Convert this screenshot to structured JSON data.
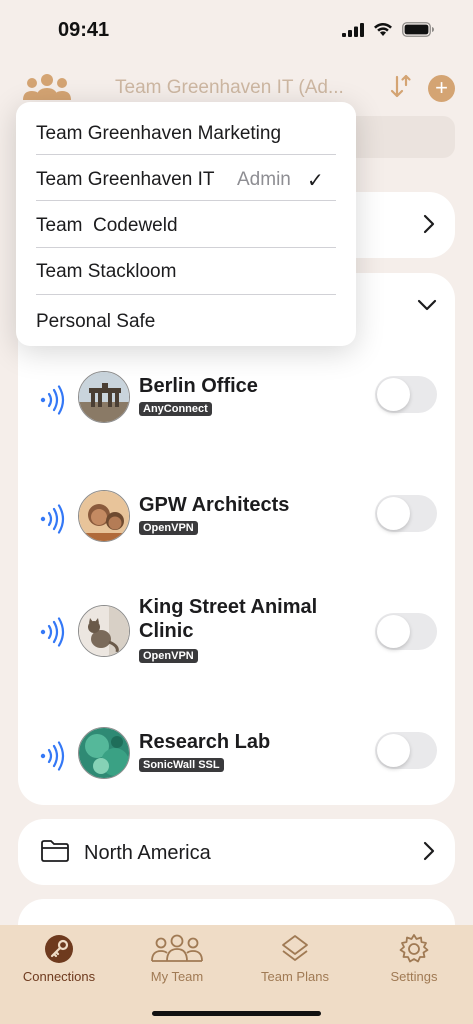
{
  "status": {
    "time": "09:41"
  },
  "nav": {
    "title": "Team Greenhaven IT (Ad..."
  },
  "team_menu": {
    "items": [
      {
        "label": "Team Greenhaven Marketing",
        "role": "",
        "checked": false
      },
      {
        "label": "Team Greenhaven IT",
        "role": "Admin",
        "checked": true
      },
      {
        "label": "Team  Codeweld",
        "role": "",
        "checked": false
      },
      {
        "label": "Team Stackloom",
        "role": "",
        "checked": false
      },
      {
        "label": "Personal Safe",
        "role": "",
        "checked": false
      }
    ],
    "check_glyph": "✓"
  },
  "connections": [
    {
      "name": "Berlin Office",
      "protocol": "AnyConnect",
      "enabled": false,
      "icon": "berlin-office-avatar"
    },
    {
      "name": "GPW Architects",
      "protocol": "OpenVPN",
      "enabled": false,
      "icon": "gpw-architects-avatar"
    },
    {
      "name": "King Street Animal Clinic",
      "protocol": "OpenVPN",
      "enabled": false,
      "icon": "king-street-avatar"
    },
    {
      "name": "Research Lab",
      "protocol": "SonicWall SSL",
      "enabled": false,
      "icon": "research-lab-avatar"
    }
  ],
  "folders": [
    {
      "label": "North America"
    }
  ],
  "tabs": [
    {
      "label": "Connections",
      "icon": "key-icon",
      "active": true
    },
    {
      "label": "My Team",
      "icon": "team-icon",
      "active": false
    },
    {
      "label": "Team Plans",
      "icon": "layers-icon",
      "active": false
    },
    {
      "label": "Settings",
      "icon": "gear-icon",
      "active": false
    }
  ],
  "colors": {
    "accent": "#d4a473",
    "tab_bg": "#efdcc6",
    "wifi_blue": "#3478f6",
    "badge_bg": "#3a3a3c"
  }
}
